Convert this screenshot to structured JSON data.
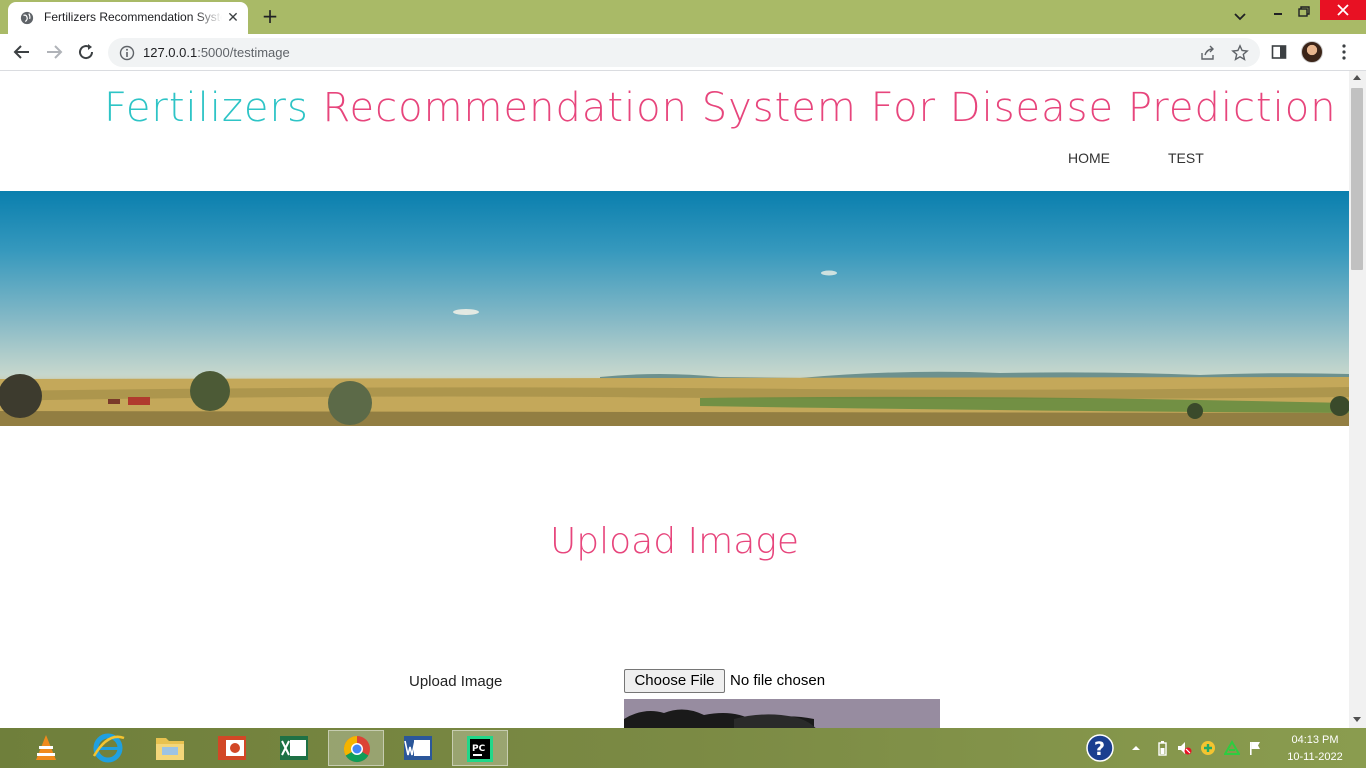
{
  "browser": {
    "tab_title": "Fertilizers Recommendation System For Disease Prediction",
    "url_host": "127.0.0.1",
    "url_rest": ":5000/testimage",
    "newtab_glyph": "+",
    "close_glyph": "✕"
  },
  "site": {
    "title_part1": "Fertilizers",
    "title_part2": "Recommendation System For Disease Prediction",
    "nav": [
      "HOME",
      "TEST"
    ],
    "title_colors": {
      "part1": "#2ec4c6",
      "part2": "#e7457c"
    }
  },
  "upload": {
    "heading": "Upload Image",
    "label": "Upload Image",
    "button_label": "Choose File",
    "status_text": "No file chosen"
  },
  "taskbar": {
    "apps": [
      "vlc-icon",
      "internet-explorer-icon",
      "file-explorer-icon",
      "powerpoint-icon",
      "excel-icon",
      "chrome-icon",
      "word-icon",
      "pycharm-icon"
    ],
    "active_app": "chrome-icon",
    "time": "04:13 PM",
    "date": "10-11-2022"
  }
}
